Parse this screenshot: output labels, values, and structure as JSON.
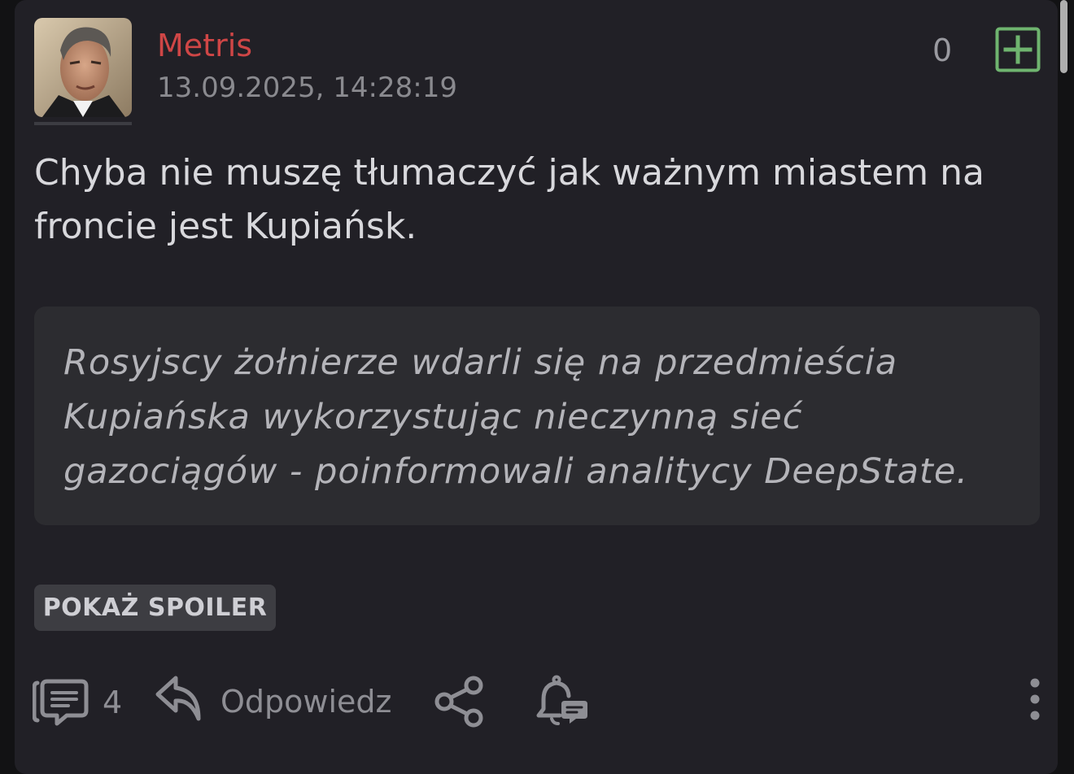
{
  "post": {
    "username": "Metris",
    "timestamp": "13.09.2025, 14:28:19",
    "vote_count": "0",
    "body": "Chyba nie muszę tłumaczyć jak ważnym miastem na froncie jest Kupiańsk.",
    "quote": "Rosyjscy żołnierze wdarli się na przedmieścia Kupiańska wykorzystując nieczynną sieć gazociągów - poinformowali analitycy DeepState.",
    "spoiler_button": "POKAŻ SPOILER"
  },
  "actions": {
    "comments_count": "4",
    "reply_label": "Odpowiedz"
  },
  "icons": {
    "vote": "plus-square-icon",
    "comments": "comments-icon",
    "reply": "reply-arrow-icon",
    "share": "share-icon",
    "notify": "bell-comment-icon",
    "more": "more-vertical-icon"
  },
  "colors": {
    "card_background": "#212026",
    "username": "#cf4646",
    "vote_accent": "#6fb46f",
    "quote_background": "#2c2c30",
    "muted_text": "#8e8e94"
  }
}
